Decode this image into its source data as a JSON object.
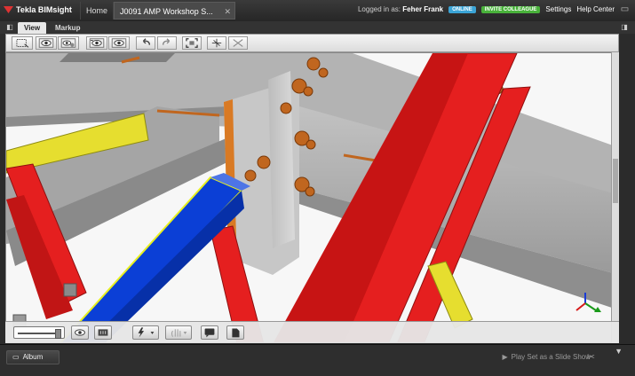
{
  "app": {
    "name": "Tekla BIMsight"
  },
  "nav": {
    "home": "Home"
  },
  "document_tab": {
    "title": "J0091 AMP Workshop S...",
    "close": "✕"
  },
  "account": {
    "logged_in_label": "Logged in as:",
    "user": "Feher Frank",
    "status_badge": "ONLINE",
    "invite_button": "INVITE COLLEAGUE",
    "settings": "Settings",
    "help": "Help Center"
  },
  "ribbon": {
    "tabs": [
      "View",
      "Markup"
    ],
    "collapse_left": "◧",
    "collapse_right": "◨"
  },
  "toolbar_icons": [
    "select-box-icon",
    "show-eye-icon",
    "show-all-icon",
    "camera-eye-icon",
    "eye-view-icon",
    "undo-icon",
    "redo-icon",
    "fit-view-icon",
    "clip-plane-icon",
    "scissors-icon"
  ],
  "bottom_toolbar_icons": [
    "transparency-slider",
    "eye-toggle-icon",
    "section-box-icon",
    "lightning-icon",
    "pan-hand-icon",
    "comment-icon",
    "document-icon"
  ],
  "status_bar": {
    "album": "Album",
    "slideshow": "Play Set as a Slide Show"
  },
  "colors": {
    "steel_red": "#e51f1f",
    "steel_blue": "#0b3fd6",
    "steel_yellow": "#e6de2f",
    "bolt_orange": "#c0661f",
    "concrete_gray": "#9c9c9c"
  }
}
